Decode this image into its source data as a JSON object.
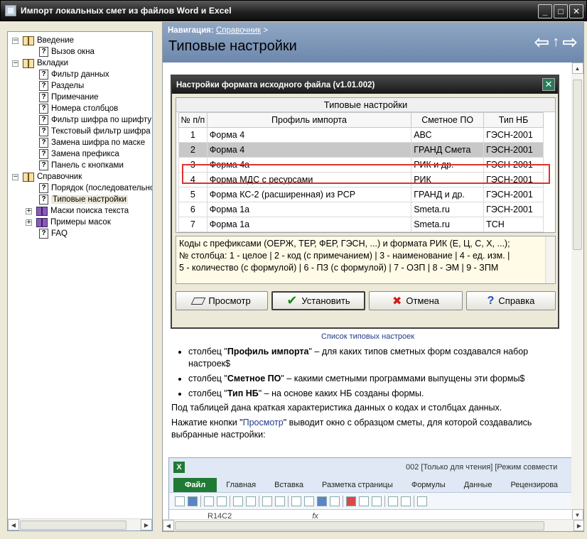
{
  "window": {
    "title": "Импорт локальных смет из файлов Word и Excel",
    "btn_minimize": "_",
    "btn_maximize": "□",
    "btn_close": "✕"
  },
  "tree": {
    "items": [
      {
        "label": "Введение",
        "level": 0,
        "icon": "book-icon",
        "expander": "−"
      },
      {
        "label": "Вызов окна",
        "level": 1,
        "icon": "help-icon"
      },
      {
        "label": "Вкладки",
        "level": 0,
        "icon": "book-icon",
        "expander": "−"
      },
      {
        "label": "Фильтр данных",
        "level": 1,
        "icon": "help-icon"
      },
      {
        "label": "Разделы",
        "level": 1,
        "icon": "help-icon"
      },
      {
        "label": "Примечание",
        "level": 1,
        "icon": "help-icon"
      },
      {
        "label": "Номера столбцов",
        "level": 1,
        "icon": "help-icon"
      },
      {
        "label": "Фильтр шифра по шрифту",
        "level": 1,
        "icon": "help-icon"
      },
      {
        "label": "Текстовый фильтр шифра",
        "level": 1,
        "icon": "help-icon"
      },
      {
        "label": "Замена шифра по маске",
        "level": 1,
        "icon": "help-icon"
      },
      {
        "label": "Замена префикса",
        "level": 1,
        "icon": "help-icon"
      },
      {
        "label": "Панель с кнопками",
        "level": 1,
        "icon": "help-icon"
      },
      {
        "label": "Справочник",
        "level": 0,
        "icon": "book-icon",
        "expander": "−"
      },
      {
        "label": "Порядок (последовательно",
        "level": 1,
        "icon": "help-icon"
      },
      {
        "label": "Типовые настройки",
        "level": 1,
        "icon": "help-icon",
        "selected": true
      },
      {
        "label": "Маски поиска текста",
        "level": 1,
        "icon": "book-icon-purple",
        "expander": "+"
      },
      {
        "label": "Примеры масок",
        "level": 1,
        "icon": "book-icon-purple",
        "expander": "+"
      },
      {
        "label": "FAQ",
        "level": 1,
        "icon": "help-icon"
      }
    ]
  },
  "nav": {
    "label": "Навигация:",
    "link": "Справочник",
    "sep": ">",
    "title": "Типовые настройки",
    "arrow_back": "⇦",
    "arrow_up": "↑",
    "arrow_forward": "⇨"
  },
  "dialog": {
    "title": "Настройки формата исходного файла (v1.01.002)",
    "close": "✕",
    "table_caption": "Типовые настройки",
    "columns": [
      "№ п/п",
      "Профиль импорта",
      "Сметное ПО",
      "Тип НБ"
    ],
    "rows": [
      {
        "n": "1",
        "profile": "Форма 4",
        "software": "АВС",
        "nb": "ГЭСН-2001"
      },
      {
        "n": "2",
        "profile": "Форма 4",
        "software": "ГРАНД Смета",
        "nb": "ГЭСН-2001"
      },
      {
        "n": "3",
        "profile": "Форма 4а",
        "software": "РИК и др.",
        "nb": "ГЭСН-2001"
      },
      {
        "n": "4",
        "profile": "Форма МДС с ресурсами",
        "software": "РИК",
        "nb": "ГЭСН-2001"
      },
      {
        "n": "5",
        "profile": "Форма КС-2 (расширенная) из РСР",
        "software": "ГРАНД и др.",
        "nb": "ГЭСН-2001"
      },
      {
        "n": "6",
        "profile": "Форма 1а",
        "software": "Smeta.ru",
        "nb": "ГЭСН-2001"
      },
      {
        "n": "7",
        "profile": "Форма 1а",
        "software": "Smeta.ru",
        "nb": "ТСН"
      }
    ],
    "info_lines": [
      "Коды с префиксами (ОЕРЖ, ТЕР, ФЕР, ГЭСН, ...) и формата РИК (Е, Ц, С, Х, ...);",
      "№ столбца: 1 - целое | 2 - код (с примечанием) | 3 - наименование | 4 - ед. изм. |",
      "5 - количество (с формулой) | 6 - ПЗ (с формулой) | 7 - ОЗП | 8 - ЭМ | 9 - ЗПМ"
    ],
    "buttons": {
      "preview": "Просмотр",
      "install": "Установить",
      "cancel": "Отмена",
      "help": "Справка"
    }
  },
  "body": {
    "caption": "Список типовых настроек",
    "b1_pre": "столбец \"",
    "b1_term": "Профиль импорта",
    "b1_post": "\" – для каких типов сметных форм создавался набор настроек$",
    "b2_pre": "столбец \"",
    "b2_term": "Сметное ПО",
    "b2_post": "\" – какими сметными программами выпущены эти формы$",
    "b3_pre": "столбец \"",
    "b3_term": "Тип НБ",
    "b3_post": "\" – на основе каких НБ созданы формы.",
    "para1": "Под таблицей дана краткая характеристика данных о кодах и столбцах данных.",
    "para2_pre": "Нажатие кнопки \"",
    "para2_q": "Просмотр",
    "para2_post": "\" выводит окно с образцом сметы, для которой создавались выбранные настройки:"
  },
  "excel": {
    "icon": "X",
    "title": "002  [Только для чтения]  [Режим совмести",
    "tabs": [
      "Файл",
      "Главная",
      "Вставка",
      "Разметка страницы",
      "Формулы",
      "Данные",
      "Рецензирова"
    ],
    "namebox": "R14C2",
    "fx": "fx"
  }
}
